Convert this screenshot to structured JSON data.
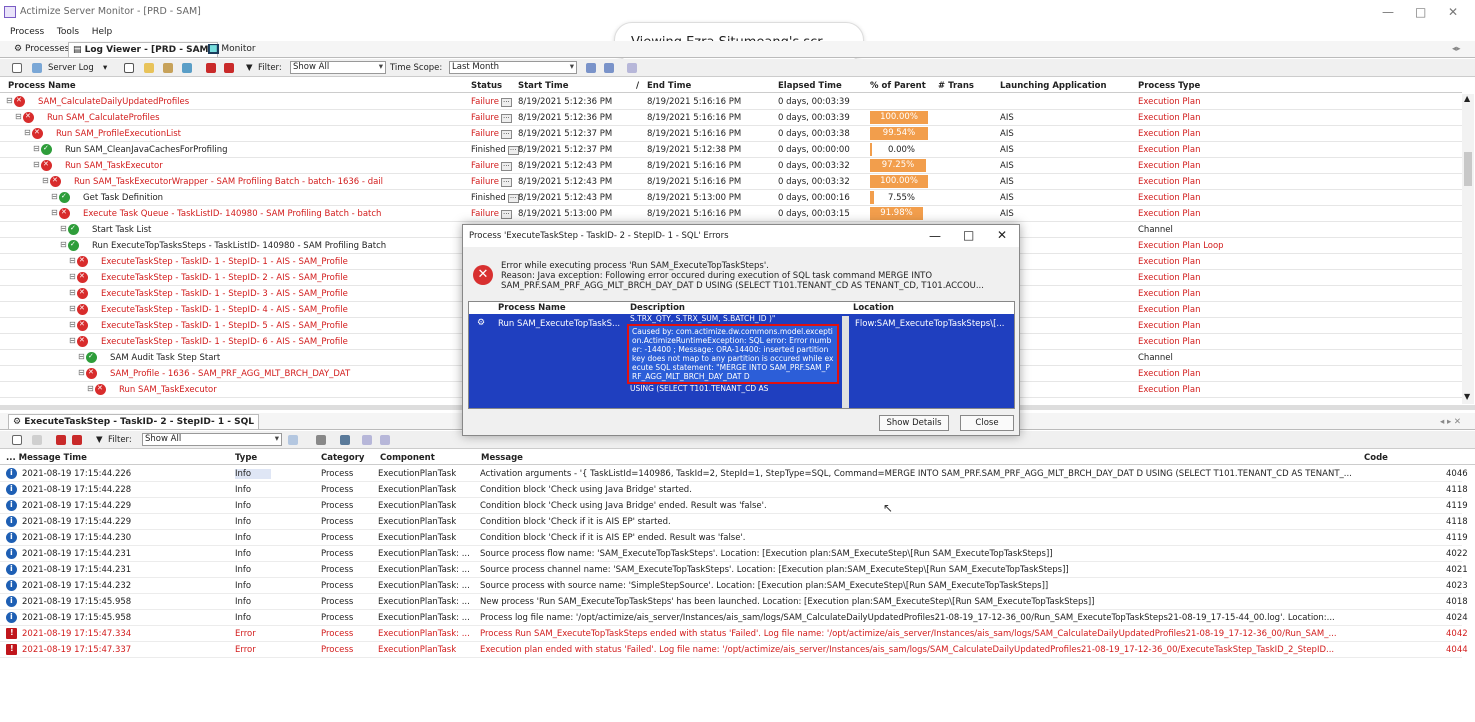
{
  "window": {
    "title": "Actimize Server Monitor - [PRD - SAM]"
  },
  "overlay": {
    "text": "Viewing Ezra Situmeang's scr..."
  },
  "menu": [
    "Process",
    "Tools",
    "Help"
  ],
  "tabs": {
    "processes": "Processes",
    "log_viewer": "Log Viewer - [PRD - SAM]",
    "monitor": "Monitor"
  },
  "toolbar": {
    "server_log": "Server Log",
    "filter_label": "Filter:",
    "filter_value": "Show All",
    "time_scope_label": "Time Scope:",
    "time_scope_value": "Last Month"
  },
  "process_table": {
    "headers": [
      "Process Name",
      "Status",
      "Start Time",
      "End Time",
      "Elapsed Time",
      "% of Parent",
      "# Trans",
      "Launching Application",
      "Process Type"
    ],
    "rows": [
      {
        "indent": 0,
        "icon": "fail",
        "name": "SAM_CalculateDailyUpdatedProfiles",
        "status": "Failure",
        "start": "8/19/2021 5:12:36 PM",
        "end": "8/19/2021 5:16:16 PM",
        "elapsed": "0 days, 00:03:39",
        "pct": "",
        "pct_value": 0,
        "app": "",
        "type": "Execution Plan",
        "red": true
      },
      {
        "indent": 1,
        "icon": "fail",
        "name": "Run SAM_CalculateProfiles",
        "status": "Failure",
        "start": "8/19/2021 5:12:36 PM",
        "end": "8/19/2021 5:16:16 PM",
        "elapsed": "0 days, 00:03:39",
        "pct": "100.00%",
        "pct_value": 100,
        "app": "AIS",
        "type": "Execution Plan",
        "red": true
      },
      {
        "indent": 2,
        "icon": "fail",
        "name": "Run SAM_ProfileExecutionList",
        "status": "Failure",
        "start": "8/19/2021 5:12:37 PM",
        "end": "8/19/2021 5:16:16 PM",
        "elapsed": "0 days, 00:03:38",
        "pct": "99.54%",
        "pct_value": 99.54,
        "app": "AIS",
        "type": "Execution Plan",
        "red": true
      },
      {
        "indent": 3,
        "icon": "ok",
        "name": "Run SAM_CleanJavaCachesForProfiling",
        "status": "Finished",
        "start": "8/19/2021 5:12:37 PM",
        "end": "8/19/2021 5:12:38 PM",
        "elapsed": "0 days, 00:00:00",
        "pct": "0.00%",
        "pct_value": 0,
        "app": "AIS",
        "type": "Execution Plan",
        "red": false
      },
      {
        "indent": 3,
        "icon": "fail",
        "name": "Run SAM_TaskExecutor",
        "status": "Failure",
        "start": "8/19/2021 5:12:43 PM",
        "end": "8/19/2021 5:16:16 PM",
        "elapsed": "0 days, 00:03:32",
        "pct": "97.25%",
        "pct_value": 97.25,
        "app": "AIS",
        "type": "Execution Plan",
        "red": true
      },
      {
        "indent": 4,
        "icon": "fail",
        "name": "Run SAM_TaskExecutorWrapper - SAM Profiling Batch - batch- 1636 - dail",
        "status": "Failure",
        "start": "8/19/2021 5:12:43 PM",
        "end": "8/19/2021 5:16:16 PM",
        "elapsed": "0 days, 00:03:32",
        "pct": "100.00%",
        "pct_value": 100,
        "app": "AIS",
        "type": "Execution Plan",
        "red": true
      },
      {
        "indent": 5,
        "icon": "ok",
        "name": "Get Task Definition",
        "status": "Finished",
        "start": "8/19/2021 5:12:43 PM",
        "end": "8/19/2021 5:13:00 PM",
        "elapsed": "0 days, 00:00:16",
        "pct": "7.55%",
        "pct_value": 7.55,
        "app": "AIS",
        "type": "Execution Plan",
        "red": false
      },
      {
        "indent": 5,
        "icon": "fail",
        "name": "Execute Task Queue - TaskListID- 140980 - SAM Profiling Batch - batch",
        "status": "Failure",
        "start": "8/19/2021 5:13:00 PM",
        "end": "8/19/2021 5:16:16 PM",
        "elapsed": "0 days, 00:03:15",
        "pct": "91.98%",
        "pct_value": 91.98,
        "app": "AIS",
        "type": "Execution Plan",
        "red": true
      },
      {
        "indent": 6,
        "icon": "ok",
        "name": "Start Task List",
        "status": "",
        "start": "",
        "end": "",
        "elapsed": "",
        "pct": "",
        "pct_value": 0,
        "app": "",
        "type": "Channel",
        "red": false
      },
      {
        "indent": 6,
        "icon": "ok",
        "name": "Run ExecuteTopTasksSteps - TaskListID- 140980 - SAM Profiling Batch",
        "status": "",
        "start": "",
        "end": "",
        "elapsed": "",
        "pct": "",
        "pct_value": 0,
        "app": "",
        "type": "Execution Plan Loop",
        "red": false
      },
      {
        "indent": 7,
        "icon": "fail",
        "name": "ExecuteTaskStep - TaskID- 1 - StepID- 1 - AIS - SAM_Profile",
        "status": "",
        "start": "",
        "end": "",
        "elapsed": "",
        "pct": "",
        "pct_value": 0,
        "app": "",
        "type": "Execution Plan",
        "red": true
      },
      {
        "indent": 7,
        "icon": "fail",
        "name": "ExecuteTaskStep - TaskID- 1 - StepID- 2 - AIS - SAM_Profile",
        "status": "",
        "start": "",
        "end": "",
        "elapsed": "",
        "pct": "",
        "pct_value": 0,
        "app": "",
        "type": "Execution Plan",
        "red": true
      },
      {
        "indent": 7,
        "icon": "fail",
        "name": "ExecuteTaskStep - TaskID- 1 - StepID- 3 - AIS - SAM_Profile",
        "status": "",
        "start": "",
        "end": "",
        "elapsed": "",
        "pct": "",
        "pct_value": 0,
        "app": "",
        "type": "Execution Plan",
        "red": true
      },
      {
        "indent": 7,
        "icon": "fail",
        "name": "ExecuteTaskStep - TaskID- 1 - StepID- 4 - AIS - SAM_Profile",
        "status": "",
        "start": "",
        "end": "",
        "elapsed": "",
        "pct": "",
        "pct_value": 0,
        "app": "",
        "type": "Execution Plan",
        "red": true
      },
      {
        "indent": 7,
        "icon": "fail",
        "name": "ExecuteTaskStep - TaskID- 1 - StepID- 5 - AIS - SAM_Profile",
        "status": "",
        "start": "",
        "end": "",
        "elapsed": "",
        "pct": "",
        "pct_value": 0,
        "app": "",
        "type": "Execution Plan",
        "red": true
      },
      {
        "indent": 7,
        "icon": "fail",
        "name": "ExecuteTaskStep - TaskID- 1 - StepID- 6 - AIS - SAM_Profile",
        "status": "",
        "start": "",
        "end": "",
        "elapsed": "",
        "pct": "",
        "pct_value": 0,
        "app": "",
        "type": "Execution Plan",
        "red": true
      },
      {
        "indent": 8,
        "icon": "ok",
        "name": "SAM Audit Task Step Start",
        "status": "",
        "start": "",
        "end": "",
        "elapsed": "",
        "pct": "",
        "pct_value": 0,
        "app": "",
        "type": "Channel",
        "red": false
      },
      {
        "indent": 8,
        "icon": "fail",
        "name": "SAM_Profile - 1636 - SAM_PRF_AGG_MLT_BRCH_DAY_DAT",
        "status": "",
        "start": "",
        "end": "",
        "elapsed": "",
        "pct": "",
        "pct_value": 0,
        "app": "",
        "type": "Execution Plan",
        "red": true
      },
      {
        "indent": 9,
        "icon": "fail",
        "name": "Run SAM_TaskExecutor",
        "status": "",
        "start": "",
        "end": "",
        "elapsed": "",
        "pct": "",
        "pct_value": 0,
        "app": "",
        "type": "Execution Plan",
        "red": true
      }
    ]
  },
  "dialog": {
    "title": "Process 'ExecuteTaskStep - TaskID- 2 - StepID- 1 - SQL' Errors",
    "message_line1": "Error while executing process 'Run SAM_ExecuteTopTaskSteps'.",
    "message_line2": "Reason: Java exception: Following error occured during execution of SQL task command MERGE INTO",
    "message_line3": "SAM_PRF.SAM_PRF_AGG_MLT_BRCH_DAY_DAT D USING (SELECT T101.TENANT_CD AS TENANT_CD, T101.ACCOU...",
    "col_process": "Process Name",
    "col_description": "Description",
    "col_location": "Location",
    "row_process": "Run SAM_ExecuteTopTaskS...",
    "row_desc_top": "S.TRX_QTY, S.TRX_SUM, S.BATCH_ID )\"",
    "row_desc_highlight": "Caused by: com.actimize.dw.commons.model.exception.ActimizeRuntimeException: SQL error: Error number: -14400 ; Message: ORA-14400: inserted partition key does not map to any partition is occured while execute SQL statement: \"MERGE INTO SAM_PRF.SAM_PRF_AGG_MLT_BRCH_DAY_DAT D",
    "row_desc_bottom": "USING (SELECT T101.TENANT_CD AS",
    "row_location": "Flow:SAM_ExecuteTopTaskSteps\\[...",
    "show_details": "Show Details",
    "close": "Close"
  },
  "bottom_tab": {
    "label": "ExecuteTaskStep - TaskID- 2 - StepID- 1 - SQL"
  },
  "bottom_toolbar": {
    "filter_label": "Filter:",
    "filter_value": "Show All"
  },
  "log_table": {
    "headers": [
      "... Message Time",
      "Type",
      "Category",
      "Component",
      "Message",
      "Code"
    ],
    "rows": [
      {
        "level": "info",
        "time": "2021-08-19 17:15:44.226",
        "type": "Info",
        "category": "Process",
        "component": "ExecutionPlanTask",
        "message": "Activation arguments - '{ TaskListId=140986, TaskId=2, StepId=1, StepType=SQL, Command=MERGE INTO SAM_PRF.SAM_PRF_AGG_MLT_BRCH_DAY_DAT D USING (SELECT T101.TENANT_CD AS TENANT_...",
        "code": "4046"
      },
      {
        "level": "info",
        "time": "2021-08-19 17:15:44.228",
        "type": "Info",
        "category": "Process",
        "component": "ExecutionPlanTask",
        "message": "Condition block 'Check using Java Bridge' started.",
        "code": "4118"
      },
      {
        "level": "info",
        "time": "2021-08-19 17:15:44.229",
        "type": "Info",
        "category": "Process",
        "component": "ExecutionPlanTask",
        "message": "Condition block 'Check using Java Bridge' ended. Result was 'false'.",
        "code": "4119"
      },
      {
        "level": "info",
        "time": "2021-08-19 17:15:44.229",
        "type": "Info",
        "category": "Process",
        "component": "ExecutionPlanTask",
        "message": "Condition block 'Check if it is AIS EP' started.",
        "code": "4118"
      },
      {
        "level": "info",
        "time": "2021-08-19 17:15:44.230",
        "type": "Info",
        "category": "Process",
        "component": "ExecutionPlanTask",
        "message": "Condition block 'Check if it is AIS EP' ended. Result was 'false'.",
        "code": "4119"
      },
      {
        "level": "info",
        "time": "2021-08-19 17:15:44.231",
        "type": "Info",
        "category": "Process",
        "component": "ExecutionPlanTask: ...",
        "message": "Source process flow name: 'SAM_ExecuteTopTaskSteps'. Location: [Execution plan:SAM_ExecuteStep\\[Run SAM_ExecuteTopTaskSteps]]",
        "code": "4022"
      },
      {
        "level": "info",
        "time": "2021-08-19 17:15:44.231",
        "type": "Info",
        "category": "Process",
        "component": "ExecutionPlanTask: ...",
        "message": "Source process channel name: 'SAM_ExecuteTopTaskSteps'. Location: [Execution plan:SAM_ExecuteStep\\[Run SAM_ExecuteTopTaskSteps]]",
        "code": "4021"
      },
      {
        "level": "info",
        "time": "2021-08-19 17:15:44.232",
        "type": "Info",
        "category": "Process",
        "component": "ExecutionPlanTask: ...",
        "message": "Source process with source name: 'SimpleStepSource'. Location: [Execution plan:SAM_ExecuteStep\\[Run SAM_ExecuteTopTaskSteps]]",
        "code": "4023"
      },
      {
        "level": "info",
        "time": "2021-08-19 17:15:45.958",
        "type": "Info",
        "category": "Process",
        "component": "ExecutionPlanTask: ...",
        "message": "New process 'Run SAM_ExecuteTopTaskSteps' has been launched. Location: [Execution plan:SAM_ExecuteStep\\[Run SAM_ExecuteTopTaskSteps]]",
        "code": "4018"
      },
      {
        "level": "info",
        "time": "2021-08-19 17:15:45.958",
        "type": "Info",
        "category": "Process",
        "component": "ExecutionPlanTask: ...",
        "message": "Process log file name: '/opt/actimize/ais_server/Instances/ais_sam/logs/SAM_CalculateDailyUpdatedProfiles21-08-19_17-12-36_00/Run_SAM_ExecuteTopTaskSteps21-08-19_17-15-44_00.log'. Location:...",
        "code": "4024"
      },
      {
        "level": "error",
        "time": "2021-08-19 17:15:47.334",
        "type": "Error",
        "category": "Process",
        "component": "ExecutionPlanTask: ...",
        "message": "Process Run SAM_ExecuteTopTaskSteps ended with status 'Failed'. Log file name: '/opt/actimize/ais_server/Instances/ais_sam/logs/SAM_CalculateDailyUpdatedProfiles21-08-19_17-12-36_00/Run_SAM_...",
        "code": "4042"
      },
      {
        "level": "error",
        "time": "2021-08-19 17:15:47.337",
        "type": "Error",
        "category": "Process",
        "component": "ExecutionPlanTask",
        "message": "Execution plan ended with status 'Failed'. Log file name: '/opt/actimize/ais_server/Instances/ais_sam/logs/SAM_CalculateDailyUpdatedProfiles21-08-19_17-12-36_00/ExecuteTaskStep_TaskID_2_StepID...",
        "code": "4044"
      }
    ]
  },
  "colors": {
    "failure_red": "#d21c1c",
    "percent_orange": "#f29e4c",
    "selection_blue": "#1f3fbf",
    "highlight_red": "#e01010"
  }
}
